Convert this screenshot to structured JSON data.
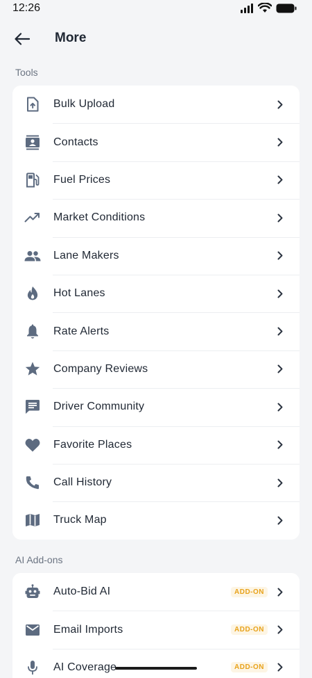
{
  "status_bar": {
    "time": "12:26"
  },
  "header": {
    "title": "More"
  },
  "sections": {
    "tools": {
      "label": "Tools",
      "items": [
        {
          "label": "Bulk Upload",
          "icon": "upload-file-icon"
        },
        {
          "label": "Contacts",
          "icon": "contacts-icon"
        },
        {
          "label": "Fuel Prices",
          "icon": "fuel-pump-icon"
        },
        {
          "label": "Market Conditions",
          "icon": "trending-up-icon"
        },
        {
          "label": "Lane Makers",
          "icon": "people-icon"
        },
        {
          "label": "Hot Lanes",
          "icon": "fire-icon"
        },
        {
          "label": "Rate Alerts",
          "icon": "bell-icon"
        },
        {
          "label": "Company Reviews",
          "icon": "star-icon"
        },
        {
          "label": "Driver Community",
          "icon": "chat-icon"
        },
        {
          "label": "Favorite Places",
          "icon": "heart-icon"
        },
        {
          "label": "Call History",
          "icon": "phone-icon"
        },
        {
          "label": "Truck Map",
          "icon": "map-icon"
        }
      ]
    },
    "ai_addons": {
      "label": "AI Add-ons",
      "badge": "ADD-ON",
      "items": [
        {
          "label": "Auto-Bid AI",
          "icon": "robot-icon"
        },
        {
          "label": "Email Imports",
          "icon": "mail-icon"
        },
        {
          "label": "AI Coverage",
          "icon": "microphone-icon"
        }
      ]
    }
  },
  "colors": {
    "icon": "#5d6b80",
    "badge_text": "#e8a21a",
    "background": "#f4f5f7"
  }
}
